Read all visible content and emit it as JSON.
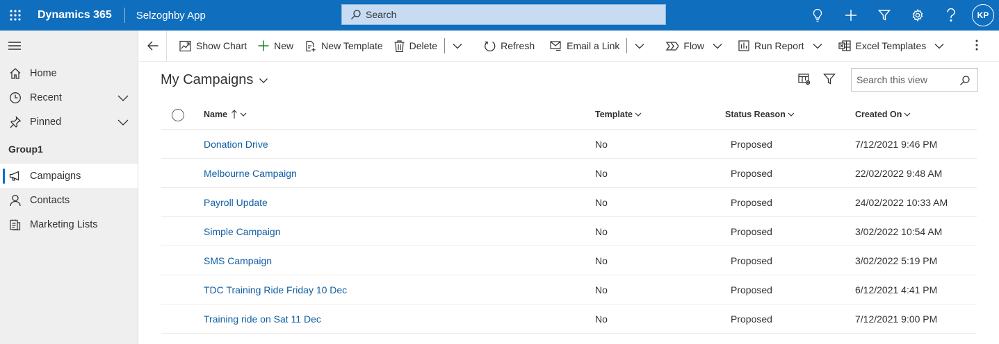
{
  "topbar": {
    "brand": "Dynamics 365",
    "app_name": "Selzoghby App",
    "search_placeholder": "Search",
    "avatar_initials": "KP"
  },
  "sidebar": {
    "items": [
      {
        "label": "Home",
        "icon": "home-icon"
      },
      {
        "label": "Recent",
        "icon": "clock-icon"
      },
      {
        "label": "Pinned",
        "icon": "pin-icon"
      }
    ],
    "group_label": "Group1",
    "group_items": [
      {
        "label": "Campaigns",
        "icon": "megaphone-icon",
        "selected": true
      },
      {
        "label": "Contacts",
        "icon": "person-icon"
      },
      {
        "label": "Marketing Lists",
        "icon": "list-icon"
      }
    ]
  },
  "commandbar": {
    "show_chart": "Show Chart",
    "new": "New",
    "new_template": "New Template",
    "delete": "Delete",
    "refresh": "Refresh",
    "email_link": "Email a Link",
    "flow": "Flow",
    "run_report": "Run Report",
    "excel_templates": "Excel Templates"
  },
  "view": {
    "title": "My Campaigns",
    "search_placeholder": "Search this view",
    "columns": {
      "name": "Name",
      "template": "Template",
      "status_reason": "Status Reason",
      "created_on": "Created On"
    },
    "rows": [
      {
        "name": "Donation Drive",
        "template": "No",
        "status": "Proposed",
        "created": "7/12/2021 9:46 PM"
      },
      {
        "name": "Melbourne Campaign",
        "template": "No",
        "status": "Proposed",
        "created": "22/02/2022 9:48 AM"
      },
      {
        "name": "Payroll Update",
        "template": "No",
        "status": "Proposed",
        "created": "24/02/2022 10:33 AM"
      },
      {
        "name": "Simple Campaign",
        "template": "No",
        "status": "Proposed",
        "created": "3/02/2022 10:54 AM"
      },
      {
        "name": "SMS Campaign",
        "template": "No",
        "status": "Proposed",
        "created": "3/02/2022 5:19 PM"
      },
      {
        "name": "TDC Training Ride Friday 10 Dec",
        "template": "No",
        "status": "Proposed",
        "created": "6/12/2021 4:41 PM"
      },
      {
        "name": "Training ride on Sat 11 Dec",
        "template": "No",
        "status": "Proposed",
        "created": "7/12/2021 9:00 PM"
      }
    ]
  },
  "colors": {
    "topbar": "#106ebe",
    "link": "#115ea3",
    "sidebar_bg": "#efefef",
    "accent": "#106ebe"
  }
}
